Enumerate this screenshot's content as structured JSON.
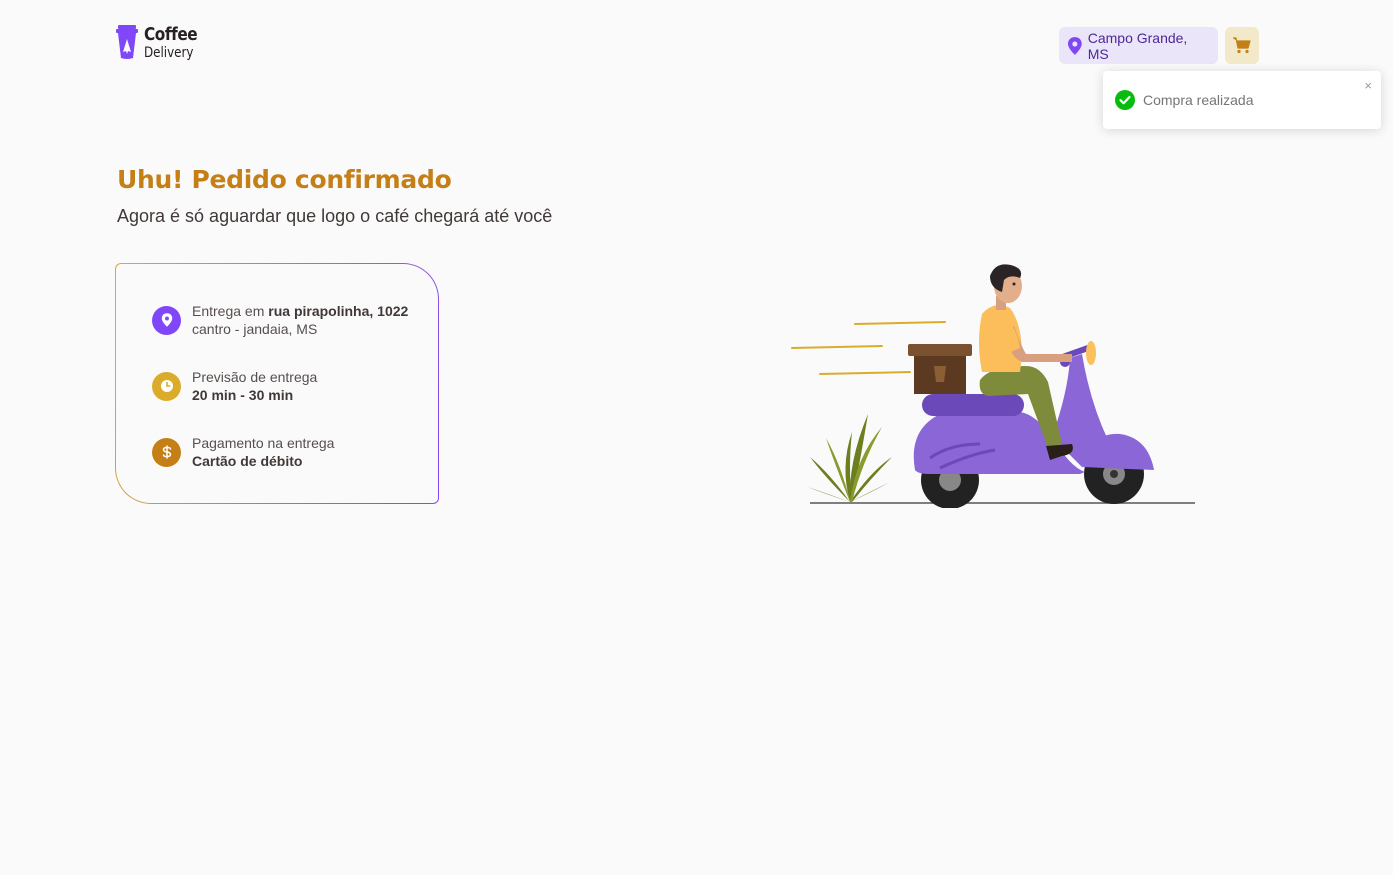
{
  "header": {
    "logo": {
      "line1": "Coffee",
      "line2": "Delivery"
    },
    "location": {
      "label": "Campo Grande, MS",
      "icon": "map-pin-icon"
    },
    "cart": {
      "icon": "shopping-cart-icon"
    }
  },
  "toast": {
    "message": "Compra realizada",
    "close_label": "×",
    "icon": "check-circle-icon"
  },
  "page": {
    "title": "Uhu! Pedido confirmado",
    "subtitle": "Agora é só aguardar que logo o café chegará até você"
  },
  "order_info": {
    "address": {
      "prefix": "Entrega em ",
      "street": "rua pirapolinha, 1022",
      "city": "cantro - jandaia, MS",
      "icon": "map-pin-icon",
      "color": "#8047F8"
    },
    "delivery_time": {
      "label": "Previsão de entrega",
      "value": "20 min - 30 min",
      "icon": "timer-icon",
      "color": "#DBAC2C"
    },
    "payment": {
      "label": "Pagamento na entrega",
      "value": "Cartão de débito",
      "icon": "currency-dollar-icon",
      "color": "#C47F17"
    }
  },
  "colors": {
    "purple": "#8047F8",
    "purple_dark": "#4B2995",
    "purple_light": "#EBE5F9",
    "yellow": "#DBAC2C",
    "yellow_dark": "#C47F17",
    "yellow_light": "#F1E9C9",
    "background": "#FAFAFA"
  }
}
